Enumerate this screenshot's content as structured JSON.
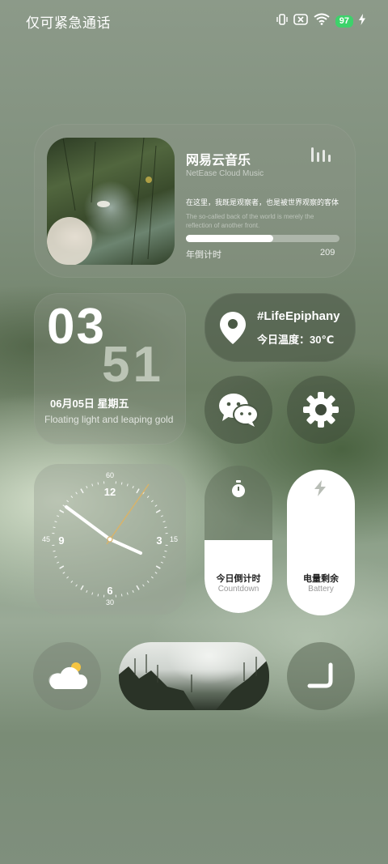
{
  "status_bar": {
    "carrier_text": "仅可紧急通话",
    "battery_level": "97",
    "icons": [
      "vibrate-icon",
      "no-sim-icon",
      "wifi-icon",
      "battery-icon",
      "charging-icon"
    ]
  },
  "music_widget": {
    "title": "网易云音乐",
    "subtitle": "NetEase Cloud Music",
    "lyric_cn": "在这里，我既是观察者，也是被世界观察的客体",
    "lyric_en": "The so-called back of the world is merely the reflection of another front.",
    "progress_label": "年倒计时",
    "progress_value": "209",
    "progress_fraction": 0.57
  },
  "time_widget": {
    "hour": "03",
    "minute": "51",
    "date": "06月05日 星期五",
    "slogan": "Floating light and leaping gold"
  },
  "location_widget": {
    "tag": "#LifeEpiphany",
    "temperature": "今日温度：30℃"
  },
  "apps": {
    "wechat": "wechat-icon",
    "settings": "gear-icon"
  },
  "clock_widget": {
    "hour_labels": [
      "12",
      "3",
      "6",
      "9"
    ],
    "minute_labels": [
      "60",
      "15",
      "30",
      "45"
    ],
    "time": "03:51"
  },
  "countdown_widget": {
    "title": "今日倒计时",
    "subtitle": "Countdown",
    "fill_fraction": 0.3
  },
  "battery_widget": {
    "title": "电量剩余",
    "subtitle": "Battery",
    "fill_fraction": 0.97
  },
  "bottom_row": {
    "weather": "partly-cloudy-icon",
    "back": "return-icon"
  },
  "colors": {
    "accent_battery": "#3dd26b",
    "second_hand": "#d8b36a"
  }
}
